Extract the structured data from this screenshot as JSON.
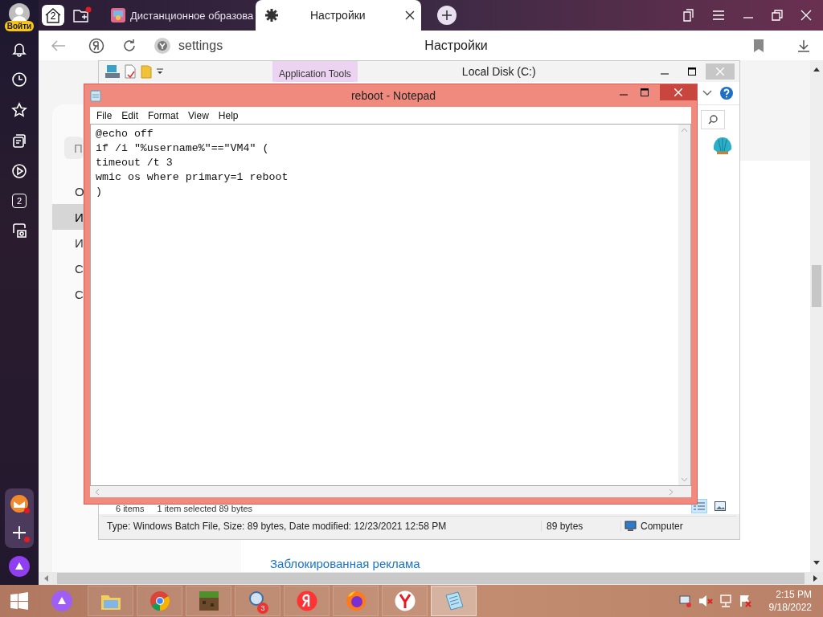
{
  "browser": {
    "account": {
      "label": "Войти"
    },
    "sidebar": [
      {
        "kind": "bell"
      },
      {
        "kind": "history"
      },
      {
        "kind": "star"
      },
      {
        "kind": "collections"
      },
      {
        "kind": "video"
      },
      {
        "kind": "counter",
        "badge": "2"
      },
      {
        "kind": "screenshot"
      }
    ],
    "sidebar_bottom": [
      {
        "kind": "mail",
        "notified": true
      },
      {
        "kind": "add",
        "notified": true
      },
      {
        "kind": "alice",
        "notified": false
      }
    ],
    "home_counter": "2",
    "tabs": [
      {
        "title": "Дистанционное образова",
        "selected": false
      },
      {
        "title": "Настройки",
        "selected": true
      }
    ],
    "address": {
      "url": "settings",
      "page_title": "Настройки"
    }
  },
  "settings_page": {
    "search": {
      "placeholder": "П"
    },
    "nav": [
      {
        "label": "О",
        "selected": false
      },
      {
        "label": "И",
        "selected": true
      },
      {
        "label": "И",
        "selected": false
      },
      {
        "label": "С",
        "selected": false
      },
      {
        "label": "С",
        "selected": false
      }
    ],
    "blocked_ads_link": "Заблокированная реклама"
  },
  "explorer": {
    "ribbon_tab": "Application Tools",
    "title": "Local Disk (C:)",
    "status": {
      "items": "6 items",
      "selection": "1 item selected  89 bytes"
    },
    "details": {
      "info": "Type: Windows Batch File, Size: 89 bytes, Date modified: 12/23/2021 12:58 PM",
      "size": "89 bytes",
      "location": "Computer"
    }
  },
  "notepad": {
    "title": "reboot - Notepad",
    "menu": [
      "File",
      "Edit",
      "Format",
      "View",
      "Help"
    ],
    "lines": [
      "@echo off",
      "if /i \"%username%\"==\"VM4\" (",
      "timeout /t 3",
      "wmic os where primary=1 reboot",
      ")"
    ]
  },
  "taskbar": {
    "apps": [
      {
        "kind": "alice",
        "active": false
      },
      {
        "kind": "files",
        "active": false
      },
      {
        "kind": "chrome",
        "active": false
      },
      {
        "kind": "blocks",
        "active": false
      },
      {
        "kind": "magnifier",
        "active": false,
        "badge": "3"
      },
      {
        "kind": "ya",
        "active": false
      },
      {
        "kind": "firefox",
        "active": false
      },
      {
        "kind": "y-browser",
        "active": false
      },
      {
        "kind": "notepad",
        "active": true
      }
    ],
    "time": "2:15 PM",
    "date": "9/18/2022"
  }
}
